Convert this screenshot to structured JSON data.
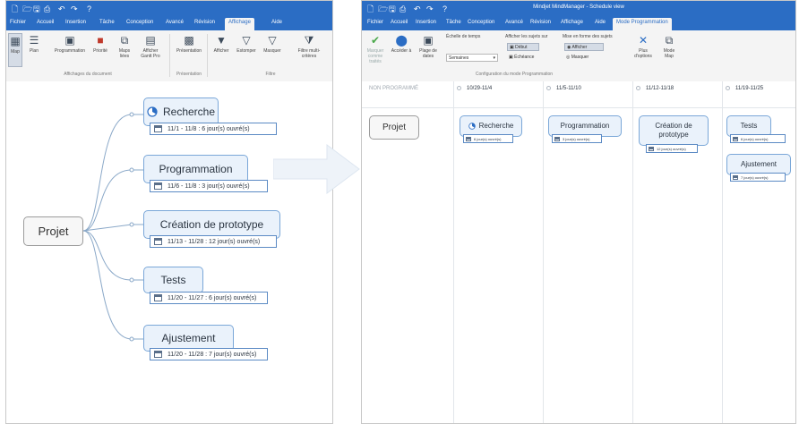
{
  "left": {
    "tabs": [
      "Fichier",
      "Accueil",
      "Insertion",
      "Tâche",
      "Conception",
      "Avancé",
      "Révision",
      "Affichage",
      "Aide"
    ],
    "active_tab": "Affichage",
    "ribbon": {
      "buttons": [
        "Map",
        "Plan",
        "Programmation",
        "Priorité",
        "Maps liées",
        "Afficher Gantt Pro",
        "Présentation",
        "Afficher",
        "Estomper",
        "Masquer",
        "Filtre multi-critères"
      ],
      "groups": [
        "Affichages du document",
        "Présentation",
        "Filtre"
      ]
    },
    "map": {
      "root": "Projet",
      "topics": [
        {
          "label": "Recherche",
          "date": "11/1 - 11/8 : 6 jour(s) ouvré(s)"
        },
        {
          "label": "Programmation",
          "date": "11/6 - 11/8 : 3 jour(s) ouvré(s)"
        },
        {
          "label": "Création de prototype",
          "date": "11/13 - 11/28 : 12 jour(s) ouvré(s)"
        },
        {
          "label": "Tests",
          "date": "11/20 - 11/27 : 6 jour(s) ouvré(s)"
        },
        {
          "label": "Ajustement",
          "date": "11/20 - 11/28 : 7 jour(s) ouvré(s)"
        }
      ]
    }
  },
  "right": {
    "title": "Mindjet MindManager - Schedule view",
    "tabs": [
      "Fichier",
      "Accueil",
      "Insertion",
      "Tâche",
      "Conception",
      "Avancé",
      "Révision",
      "Affichage",
      "Aide",
      "Mode Programmation"
    ],
    "active_tab": "Mode Programmation",
    "ribbon": {
      "marquer_label": "Marquer comme traités",
      "acceder_label": "Accéder à",
      "plage_label": "Plage de dates",
      "echelle_label": "Échelle de temps",
      "echelle_value": "Semaines",
      "afficher_sujets_label": "Afficher les sujets sur",
      "debut_label": "Début",
      "echeance_label": "Échéance",
      "mise_en_forme_label": "Mise en forme des sujets",
      "afficher_label": "Afficher",
      "masquer_label": "Masquer",
      "plus_options_label": "Plus d'options",
      "mode_map_label": "Mode Map",
      "group_label": "Configuration du mode Programmation"
    },
    "schedule": {
      "columns": [
        "NON PROGRAMMÉ",
        "10/29-11/4",
        "11/5-11/10",
        "11/12-11/18",
        "11/19-11/25"
      ],
      "root": "Projet",
      "topics": [
        {
          "label": "Recherche",
          "date": "6 jour(s) ouvré(s)"
        },
        {
          "label": "Programmation",
          "date": "3 jour(s) ouvré(s)"
        },
        {
          "label": "Création de prototype",
          "date": "12 jour(s) ouvré(s)"
        },
        {
          "label": "Tests",
          "date": "6 jour(s) ouvré(s)"
        },
        {
          "label": "Ajustement",
          "date": "7 jour(s) ouvré(s)"
        }
      ]
    }
  }
}
